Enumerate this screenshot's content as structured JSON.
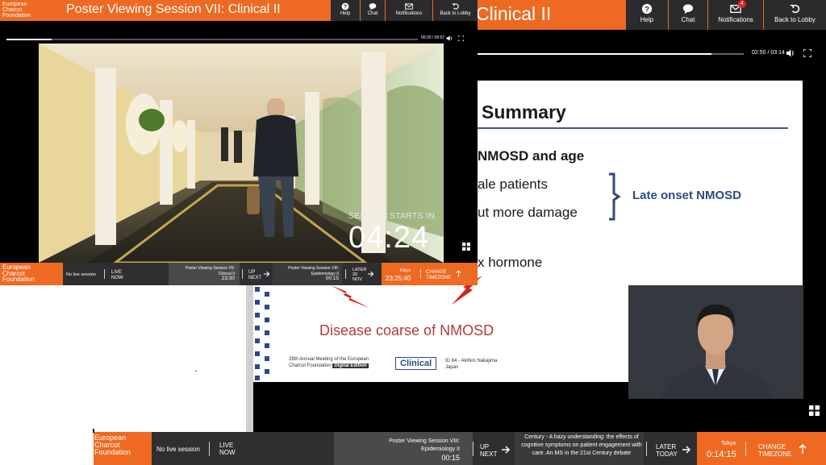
{
  "brand": {
    "logo_text": [
      "European",
      "Charcot",
      "Foundation"
    ],
    "accent": "#ee6a23",
    "dark": "#2b2b2d"
  },
  "bg_window": {
    "title": "Clinical II",
    "nav": [
      {
        "label": "Help",
        "icon": "help-icon"
      },
      {
        "label": "Chat",
        "icon": "chat-icon"
      },
      {
        "label": "Notifications",
        "icon": "mail-icon",
        "badge": "4"
      },
      {
        "label": "Back to Lobby",
        "icon": "back-icon"
      }
    ],
    "player": {
      "time": "02:50 / 03:14",
      "progress": 0.88
    },
    "slide": {
      "heading": "Summary",
      "line1": "NMOSD and age",
      "line2": "ale patients",
      "line3": "ut more damage",
      "line4": "x hormone",
      "bracket_label": "Late onset NMOSD"
    },
    "poster": {
      "title": "Disease coarse of NMOSD",
      "footer_line1": "28th Annual Meeting of the European",
      "footer_line2": "Charcot Foundation",
      "footer_digital": "Digital Edition",
      "badge": "Clinical",
      "id_line1": "ID 84 - Akihiro Nakajima",
      "id_line2": "Japan"
    },
    "bottom": {
      "live_status": "No live session",
      "live_now": [
        "LIVE",
        "NOW"
      ],
      "next_session_title": "Poster Viewing Session VIII:",
      "next_session_sub": "Epidemiology II",
      "next_session_time": "00:15",
      "up_next": [
        "UP",
        "NEXT"
      ],
      "later_text": "Century - A hazy understanding: the effects of cognitive symptoms on patient engagement with care. An MS in the 21st Century debate",
      "later_today": [
        "LATER",
        "TODAY"
      ],
      "tz_city": "Tokyo",
      "tz_time": "0:14:15",
      "change_tz": [
        "CHANGE",
        "TIMEZONE"
      ]
    }
  },
  "fg_window": {
    "title": "Poster Viewing Session VII: Clinical II",
    "nav": [
      {
        "label": "Help",
        "icon": "help-icon"
      },
      {
        "label": "Chat",
        "icon": "chat-icon"
      },
      {
        "label": "Notifications",
        "icon": "mail-icon"
      },
      {
        "label": "Back to Lobby",
        "icon": "back-icon"
      }
    ],
    "player": {
      "time": "00:20 / 00:57",
      "progress": 0.11
    },
    "session_starts_label": "SESSION STARTS IN",
    "countdown": "04:24",
    "bottom": {
      "live_status": "No live session",
      "live_now": [
        "LIVE",
        "NOW"
      ],
      "current_title": "Poster Viewing Session VII:",
      "current_sub": "Clinical II",
      "current_time": "23:30",
      "up_next": [
        "UP",
        "NEXT"
      ],
      "next_title": "Poster Viewing Session VIII:",
      "next_sub": "Epidemiology II",
      "next_time": "00:15",
      "later": [
        "LATER",
        "20",
        "NOV"
      ],
      "tz_city": "Tokyo",
      "tz_time": "23:25:40",
      "change_tz": [
        "CHANGE",
        "TIMEZONE"
      ]
    }
  }
}
